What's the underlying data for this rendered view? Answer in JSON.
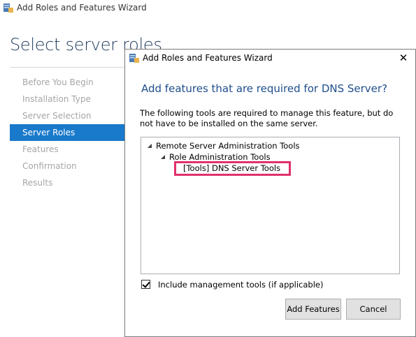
{
  "background": {
    "window_title": "Add Roles and Features Wizard",
    "page_heading": "Select server roles",
    "nav_items": [
      {
        "label": "Before You Begin",
        "active": false
      },
      {
        "label": "Installation Type",
        "active": false
      },
      {
        "label": "Server Selection",
        "active": false
      },
      {
        "label": "Server Roles",
        "active": true
      },
      {
        "label": "Features",
        "active": false
      },
      {
        "label": "Confirmation",
        "active": false
      },
      {
        "label": "Results",
        "active": false
      }
    ]
  },
  "dialog": {
    "title": "Add Roles and Features Wizard",
    "close_label": "✕",
    "heading": "Add features that are required for DNS Server?",
    "description": "The following tools are required to manage this feature, but do not have to be installed on the same server.",
    "tree": {
      "root": "Remote Server Administration Tools",
      "child": "Role Administration Tools",
      "leaf": "[Tools] DNS Server Tools"
    },
    "include_tools_label": "Include management tools (if applicable)",
    "include_tools_checked": true,
    "add_button": "Add Features",
    "cancel_button": "Cancel"
  },
  "colors": {
    "active_nav": "#1979ca",
    "heading_blue": "#1e4e8c",
    "highlight": "#e0306e"
  }
}
